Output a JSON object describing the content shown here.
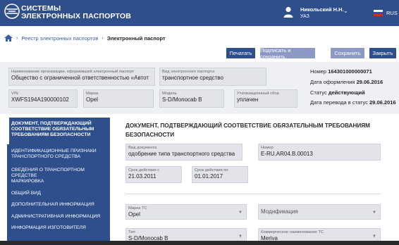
{
  "header": {
    "brand_line1": "СИСТЕМЫ",
    "brand_line2": "ЭЛЕКТРОННЫХ ПАСПОРТОВ",
    "user_name": "Никольский Н.Н.",
    "user_org": "УАЗ",
    "language": "RUS",
    "icons": {
      "logo": "globe-logo-icon",
      "user": "user-icon",
      "chevron": "chevron-down-icon",
      "flag": "russia-flag-icon"
    }
  },
  "breadcrumb": {
    "items": [
      "Реестр электронных паспортов",
      "Электронный паспорт"
    ]
  },
  "actions": {
    "print": "Печатать",
    "sign_save": "Подписать и сохранить",
    "save": "Сохранить",
    "close": "Закрыть"
  },
  "header_form": {
    "org_label": "Наименование организации, оформившей электронный паспорт",
    "org_value": "Общество с ограниченной ответственностью «Автот",
    "kind_label": "Вид электронного паспорта",
    "kind_value": "транспортное средство",
    "vin_label": "VIN",
    "vin_value": "XWFS194A190000102",
    "brand_label": "Марка",
    "brand_value": "Opel",
    "model_label": "Модель",
    "model_value": "S-D/Monocab B",
    "fee_label": "Утилизационный сбор",
    "fee_value": "уплачен"
  },
  "info": {
    "number_label": "Номер",
    "number_value": "164301000000071",
    "issue_label": "Дата оформления",
    "issue_value": "29.06.2016",
    "status_label": "Статус",
    "status_value": "действующий",
    "transfer_label": "Дата перевода в статус",
    "transfer_value": "29.06.2016"
  },
  "sidebar": {
    "items": [
      "Документ, подтверждающий соответствие обязательным требованиям безопасности",
      "Идентификационные признаки транспортного средства",
      "Сведения о транспортном средстве",
      "Маркировка",
      "Общий вид",
      "Дополнительная информация",
      "Административная информация",
      "Информация изготовителя"
    ]
  },
  "main": {
    "title": "Документ, подтверждающий соответствие обязательным требованиям безопасности",
    "doc_kind_label": "Вид документа",
    "doc_kind_value": "одобрение типа транспортного средства",
    "doc_number_label": "Номер",
    "doc_number_value": "E-RU.AR04.B.00013",
    "valid_from_label": "Срок действия с",
    "valid_from_value": "21.03.2011",
    "valid_to_label": "Срок действия по",
    "valid_to_value": "01.01.2017",
    "brand_ts_label": "Марка ТС",
    "brand_ts_value": "Opel",
    "modification_placeholder": "Модификация",
    "type_label": "Тип",
    "type_value": "S-D/Monocab B",
    "trade_name_label": "Коммерческое наименование ТС",
    "trade_name_value": "Meriva"
  },
  "colors": {
    "primary": "#2e4f8c",
    "secondary_button": "#8c99c4",
    "header_bg": "#eef0f4"
  }
}
